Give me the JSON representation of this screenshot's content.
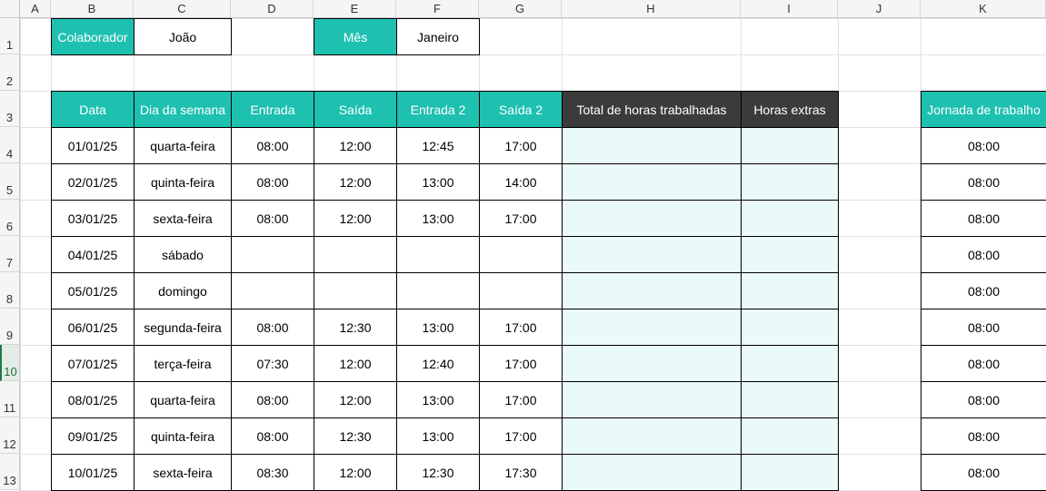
{
  "columns": [
    "A",
    "B",
    "C",
    "D",
    "E",
    "F",
    "G",
    "H",
    "I",
    "J",
    "K"
  ],
  "rows": [
    "1",
    "2",
    "3",
    "4",
    "5",
    "6",
    "7",
    "8",
    "9",
    "10",
    "11",
    "12",
    "13"
  ],
  "info": {
    "colaborador_label": "Colaborador",
    "colaborador_value": "João",
    "mes_label": "Mês",
    "mes_value": "Janeiro"
  },
  "table": {
    "headers": [
      "Data",
      "Dia da semana",
      "Entrada",
      "Saída",
      "Entrada 2",
      "Saída 2",
      "Total de horas trabalhadas",
      "Horas extras"
    ],
    "rows": [
      [
        "01/01/25",
        "quarta-feira",
        "08:00",
        "12:00",
        "12:45",
        "17:00",
        "",
        ""
      ],
      [
        "02/01/25",
        "quinta-feira",
        "08:00",
        "12:00",
        "13:00",
        "14:00",
        "",
        ""
      ],
      [
        "03/01/25",
        "sexta-feira",
        "08:00",
        "12:00",
        "13:00",
        "17:00",
        "",
        ""
      ],
      [
        "04/01/25",
        "sábado",
        "",
        "",
        "",
        "",
        "",
        ""
      ],
      [
        "05/01/25",
        "domingo",
        "",
        "",
        "",
        "",
        "",
        ""
      ],
      [
        "06/01/25",
        "segunda-feira",
        "08:00",
        "12:30",
        "13:00",
        "17:00",
        "",
        ""
      ],
      [
        "07/01/25",
        "terça-feira",
        "07:30",
        "12:00",
        "12:40",
        "17:00",
        "",
        ""
      ],
      [
        "08/01/25",
        "quarta-feira",
        "08:00",
        "12:00",
        "13:00",
        "17:00",
        "",
        ""
      ],
      [
        "09/01/25",
        "quinta-feira",
        "08:00",
        "12:30",
        "13:00",
        "17:00",
        "",
        ""
      ],
      [
        "10/01/25",
        "sexta-feira",
        "08:30",
        "12:00",
        "12:30",
        "17:30",
        "",
        ""
      ]
    ]
  },
  "jornada": {
    "header": "Jornada de trabalho",
    "values": [
      "08:00",
      "08:00",
      "08:00",
      "08:00",
      "08:00",
      "08:00",
      "08:00",
      "08:00",
      "08:00",
      "08:00"
    ]
  },
  "colors": {
    "teal": "#1ec0b0",
    "dark": "#3b3b3b",
    "light": "#eafaf8"
  },
  "active_row": "10"
}
